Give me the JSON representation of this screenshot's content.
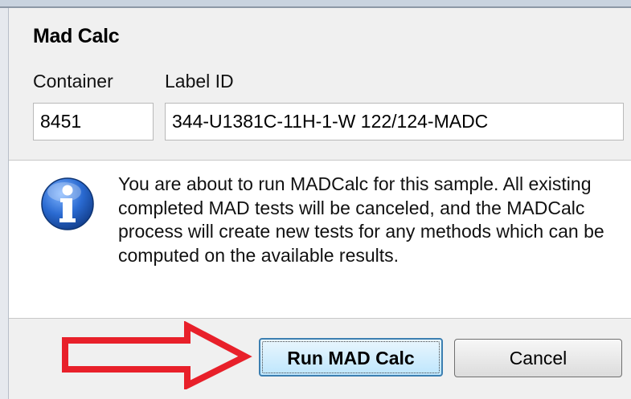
{
  "dialog": {
    "title": "Mad Calc",
    "container_label": "Container",
    "label_id_label": "Label ID",
    "container_value": "8451",
    "label_id_value": "344-U1381C-11H-1-W 122/124-MADC",
    "message": "You are about to run MADCalc for this sample.  All existing completed MAD tests will be canceled, and the MADCalc process will create new tests for any methods which can be computed on the available results.",
    "info_icon": "info-icon"
  },
  "buttons": {
    "run_label": "Run MAD Calc",
    "cancel_label": "Cancel"
  },
  "annotation": {
    "arrow": "red-outline-arrow",
    "arrow_color": "#e8202a"
  },
  "colors": {
    "dialog_bg": "#f0f0f0",
    "info_panel_bg": "#ffffff",
    "focus_button_border": "#3c7fb1",
    "info_icon_blue": "#1f5fb8"
  }
}
